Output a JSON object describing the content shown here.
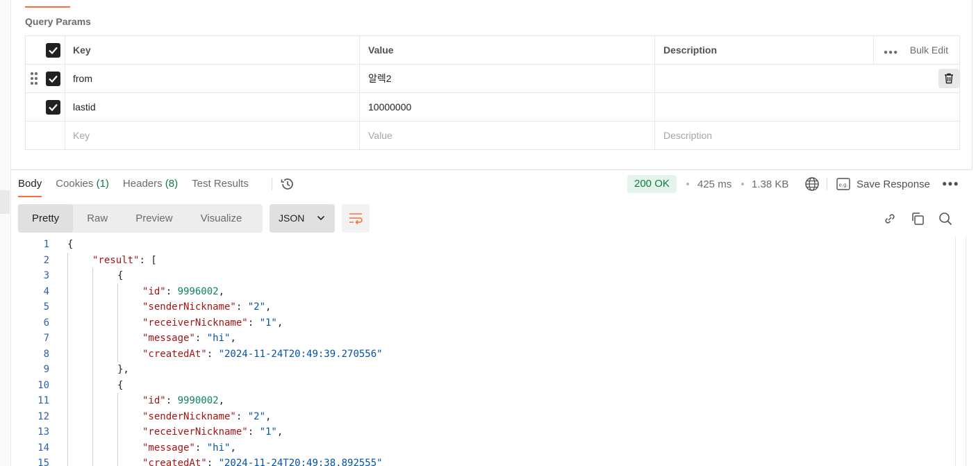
{
  "query_params": {
    "title": "Query Params",
    "headers": {
      "key": "Key",
      "value": "Value",
      "description": "Description",
      "bulk_edit": "Bulk Edit"
    },
    "rows": [
      {
        "checked": true,
        "key": "from",
        "value": "알렉2",
        "description": ""
      },
      {
        "checked": true,
        "key": "lastid",
        "value": "10000000",
        "description": ""
      }
    ],
    "placeholders": {
      "key": "Key",
      "value": "Value",
      "description": "Description"
    }
  },
  "response": {
    "tabs": [
      {
        "label": "Body",
        "count": ""
      },
      {
        "label": "Cookies",
        "count": "(1)"
      },
      {
        "label": "Headers",
        "count": "(8)"
      },
      {
        "label": "Test Results",
        "count": ""
      }
    ],
    "status": "200 OK",
    "time": "425 ms",
    "size": "1.38 KB",
    "save_label": "Save Response",
    "view_modes": [
      "Pretty",
      "Raw",
      "Preview",
      "Visualize"
    ],
    "format": "JSON"
  },
  "colors": {
    "accent": "#ff6c37",
    "status_ok": "#0f7b3f",
    "json_key": "#a31515",
    "json_string": "#0451a5",
    "json_number": "#098658"
  },
  "code_lines": [
    {
      "n": "1",
      "indent": 0,
      "tokens": [
        [
          "p",
          "{"
        ]
      ]
    },
    {
      "n": "2",
      "indent": 1,
      "tokens": [
        [
          "k",
          "\"result\""
        ],
        [
          "p",
          ": ["
        ]
      ]
    },
    {
      "n": "3",
      "indent": 2,
      "tokens": [
        [
          "p",
          "{"
        ]
      ]
    },
    {
      "n": "4",
      "indent": 3,
      "tokens": [
        [
          "k",
          "\"id\""
        ],
        [
          "p",
          ": "
        ],
        [
          "n",
          "9996002"
        ],
        [
          "p",
          ","
        ]
      ]
    },
    {
      "n": "5",
      "indent": 3,
      "tokens": [
        [
          "k",
          "\"senderNickname\""
        ],
        [
          "p",
          ": "
        ],
        [
          "s",
          "\"2\""
        ],
        [
          "p",
          ","
        ]
      ]
    },
    {
      "n": "6",
      "indent": 3,
      "tokens": [
        [
          "k",
          "\"receiverNickname\""
        ],
        [
          "p",
          ": "
        ],
        [
          "s",
          "\"1\""
        ],
        [
          "p",
          ","
        ]
      ]
    },
    {
      "n": "7",
      "indent": 3,
      "tokens": [
        [
          "k",
          "\"message\""
        ],
        [
          "p",
          ": "
        ],
        [
          "s",
          "\"hi\""
        ],
        [
          "p",
          ","
        ]
      ]
    },
    {
      "n": "8",
      "indent": 3,
      "tokens": [
        [
          "k",
          "\"createdAt\""
        ],
        [
          "p",
          ": "
        ],
        [
          "s",
          "\"2024-11-24T20:49:39.270556\""
        ]
      ]
    },
    {
      "n": "9",
      "indent": 2,
      "tokens": [
        [
          "p",
          "},"
        ]
      ]
    },
    {
      "n": "10",
      "indent": 2,
      "tokens": [
        [
          "p",
          "{"
        ]
      ]
    },
    {
      "n": "11",
      "indent": 3,
      "tokens": [
        [
          "k",
          "\"id\""
        ],
        [
          "p",
          ": "
        ],
        [
          "n",
          "9990002"
        ],
        [
          "p",
          ","
        ]
      ]
    },
    {
      "n": "12",
      "indent": 3,
      "tokens": [
        [
          "k",
          "\"senderNickname\""
        ],
        [
          "p",
          ": "
        ],
        [
          "s",
          "\"2\""
        ],
        [
          "p",
          ","
        ]
      ]
    },
    {
      "n": "13",
      "indent": 3,
      "tokens": [
        [
          "k",
          "\"receiverNickname\""
        ],
        [
          "p",
          ": "
        ],
        [
          "s",
          "\"1\""
        ],
        [
          "p",
          ","
        ]
      ]
    },
    {
      "n": "14",
      "indent": 3,
      "tokens": [
        [
          "k",
          "\"message\""
        ],
        [
          "p",
          ": "
        ],
        [
          "s",
          "\"hi\""
        ],
        [
          "p",
          ","
        ]
      ]
    },
    {
      "n": "15",
      "indent": 3,
      "tokens": [
        [
          "k",
          "\"createdAt\""
        ],
        [
          "p",
          ": "
        ],
        [
          "s",
          "\"2024-11-24T20:49:38.892555\""
        ]
      ]
    }
  ]
}
